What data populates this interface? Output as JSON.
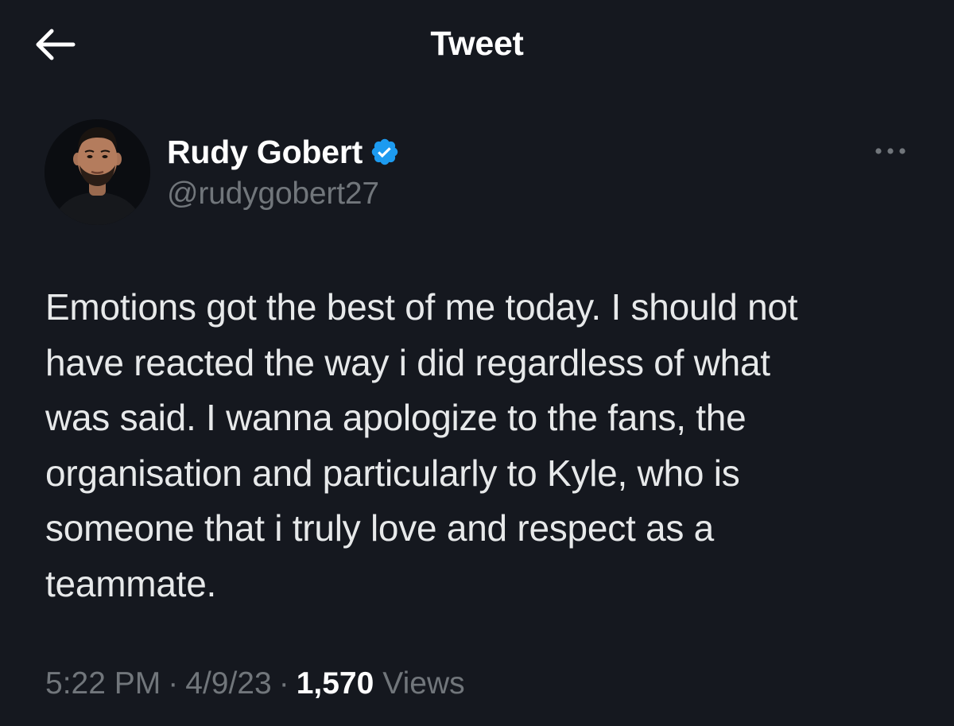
{
  "header": {
    "title": "Tweet",
    "back_icon": "arrow-left-icon"
  },
  "author": {
    "display_name": "Rudy Gobert",
    "handle": "@rudygobert27",
    "verified_icon": "verified-badge-icon",
    "avatar_icon": "profile-photo"
  },
  "menu": {
    "more_icon": "more-horizontal-icon"
  },
  "tweet": {
    "text": "Emotions got the best of me today. I should not\nhave reacted the way i did regardless of what\nwas said. I wanna apologize to the fans, the\norganisation and particularly to Kyle, who is\nsomeone that i truly love and respect as a\nteammate."
  },
  "meta": {
    "time": "5:22 PM",
    "separator": "·",
    "date": "4/9/23",
    "views_count": "1,570",
    "views_label": "Views"
  },
  "colors": {
    "background": "#15181f",
    "text_primary": "#e7e9ea",
    "text_secondary": "#71767b",
    "verified_blue": "#1d9bf0"
  }
}
